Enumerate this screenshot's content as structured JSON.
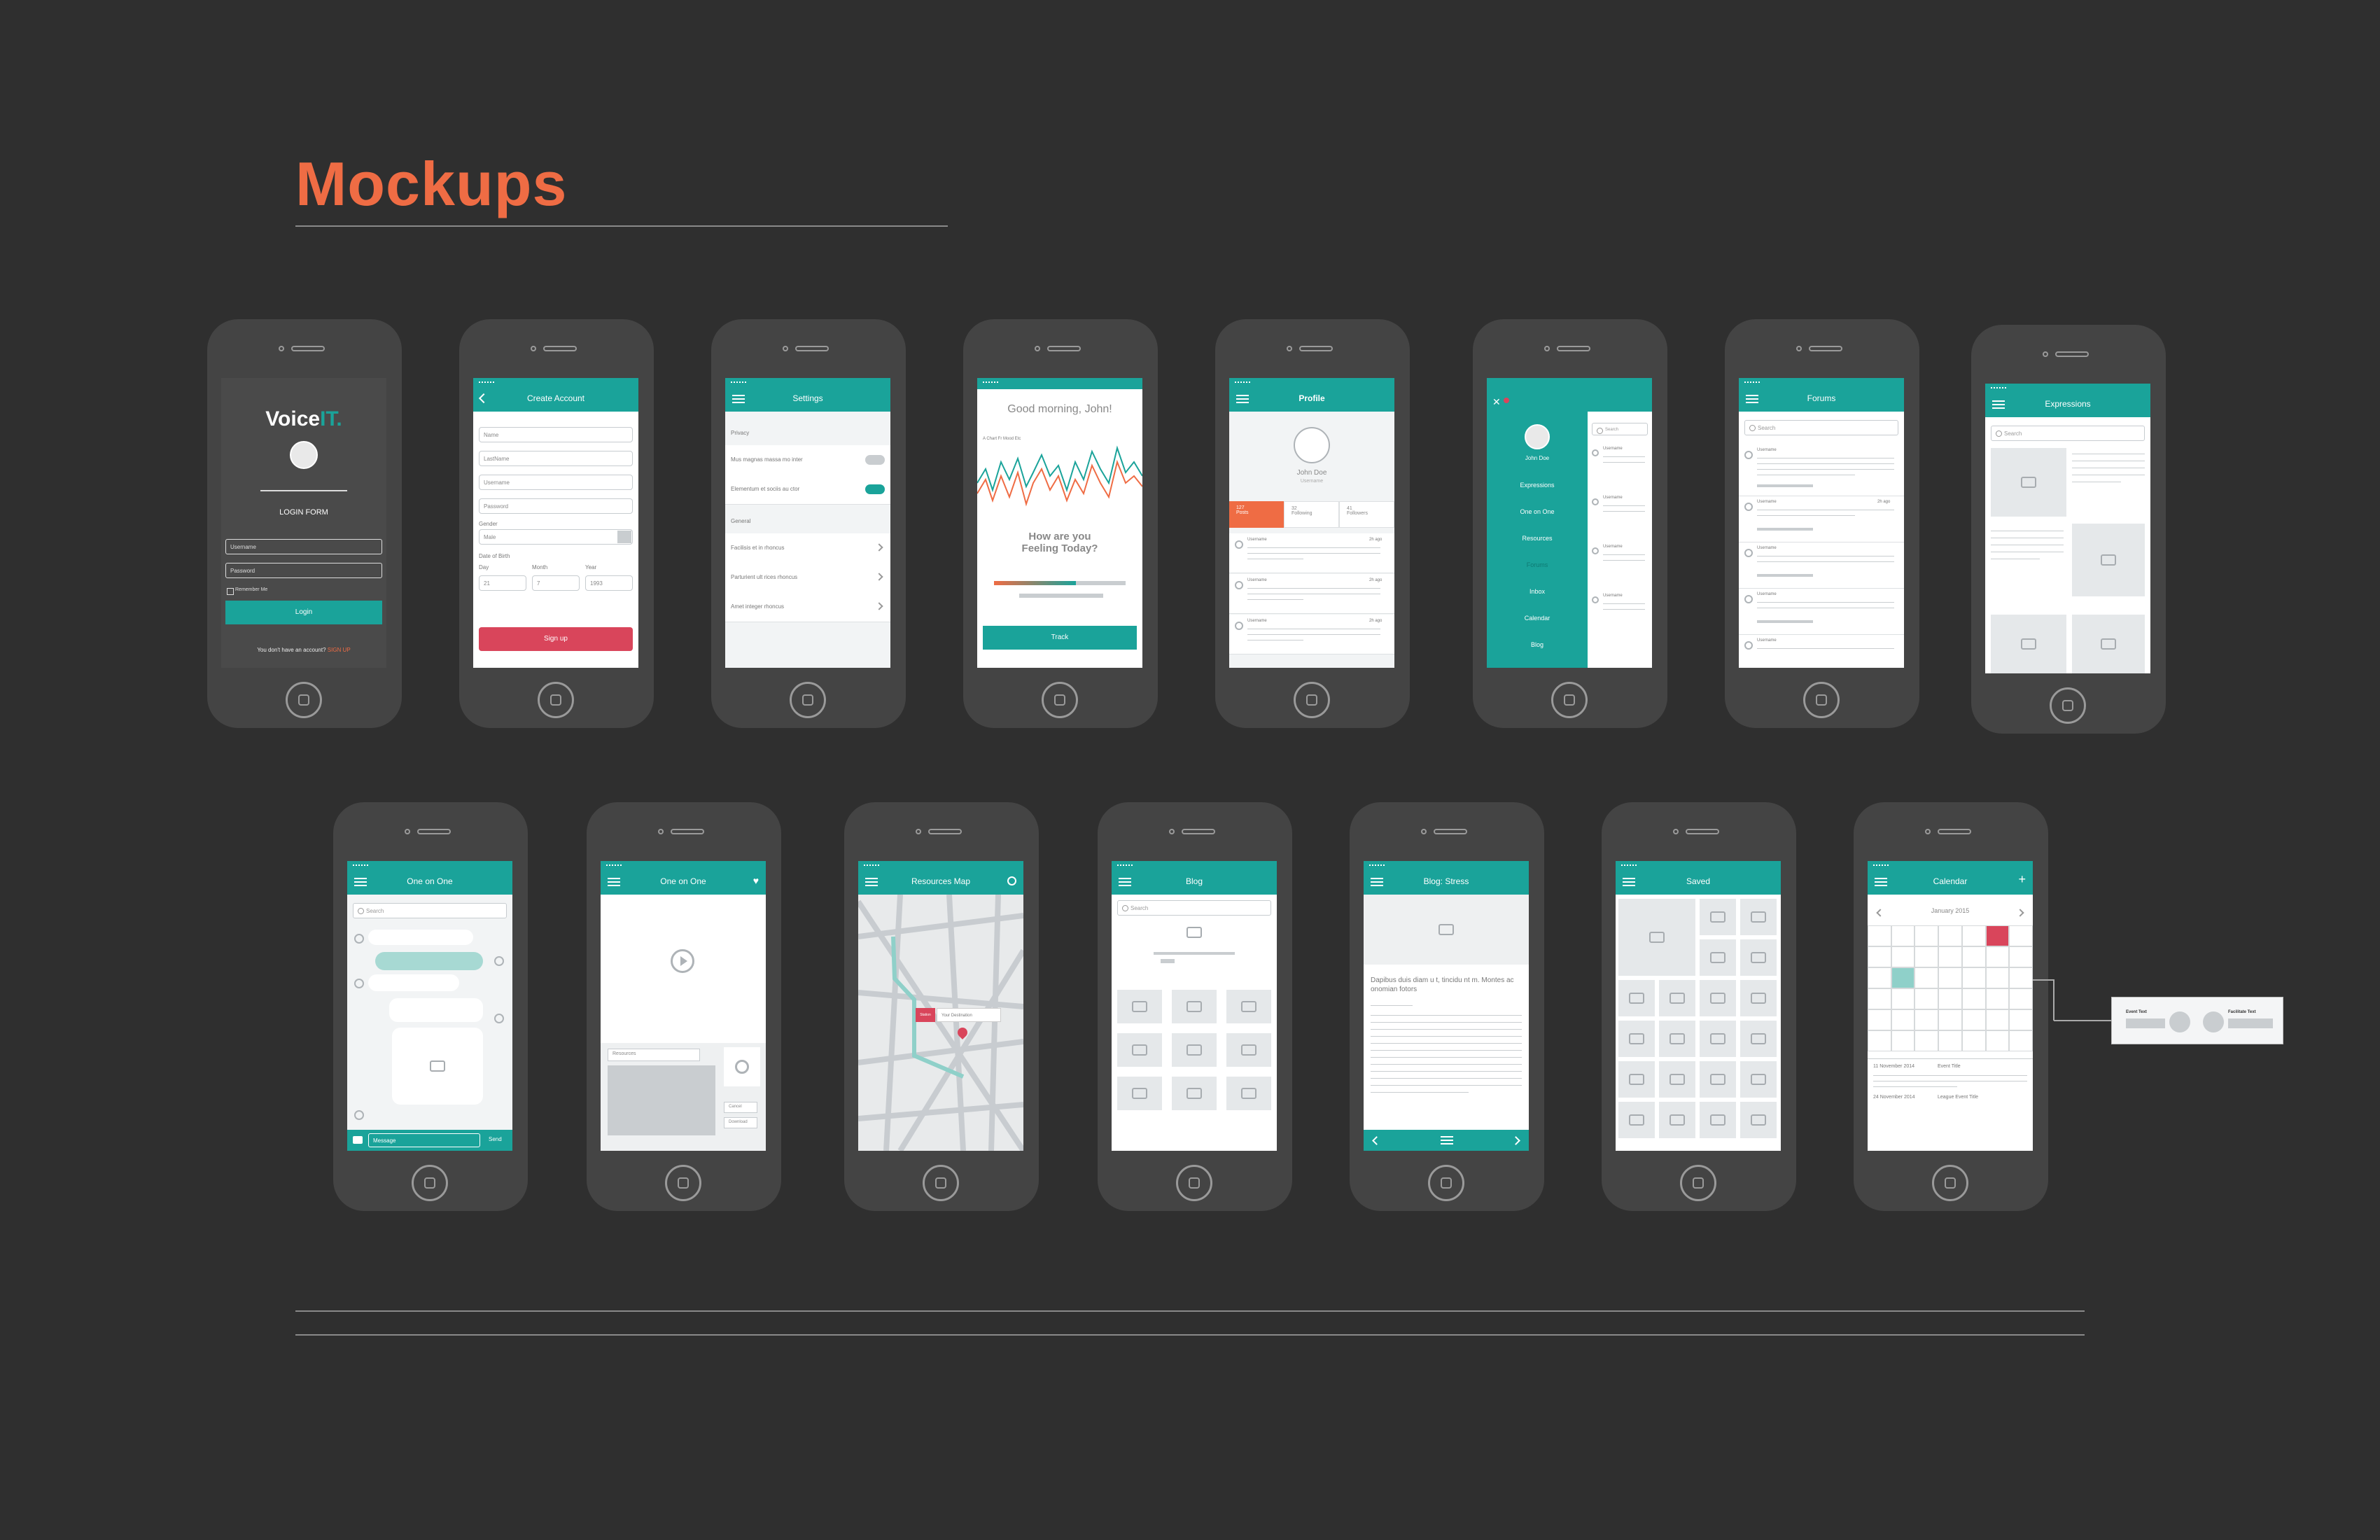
{
  "page": {
    "title": "Mockups",
    "accent": "#ef6c44",
    "teal": "#1aa39a",
    "red": "#d9455b"
  },
  "login": {
    "logo_a": "Voice",
    "logo_b": "IT.",
    "form_title": "LOGIN FORM",
    "username": "Username",
    "password": "Password",
    "remember": "Remember Me",
    "button": "Login",
    "no_account": "You don't have an account?",
    "signup": "SIGN UP"
  },
  "create": {
    "title": "Create Account",
    "fields": [
      "Name",
      "LastName",
      "Username",
      "Password"
    ],
    "gender_label": "Gender",
    "gender_value": "Male",
    "dob_label": "Date of Birth",
    "day_label": "Day",
    "month_label": "Month",
    "year_label": "Year",
    "day": "21",
    "month": "7",
    "year": "1993",
    "button": "Sign up"
  },
  "settings": {
    "title": "Settings",
    "privacy": "Privacy",
    "toggles": [
      "Mus magnas massa mo inter",
      "Elementum et sociis au ctor"
    ],
    "general": "General",
    "items": [
      "Facilisis et in rhoncus",
      "Parturient ult rices rhoncus",
      "Amet integer rhoncus"
    ]
  },
  "track": {
    "greeting": "Good morning, John!",
    "chart_label": "A Chart Fr Mood Etc",
    "question": "How are you Feeling Today?",
    "button": "Track",
    "mood_level": 0.62
  },
  "profile": {
    "title": "Profile",
    "name": "John Doe",
    "sub": "Username",
    "stats": [
      {
        "n": "127",
        "l": "Posts"
      },
      {
        "n": "32",
        "l": "Following"
      },
      {
        "n": "41",
        "l": "Followers"
      }
    ],
    "post_user": "Username",
    "post_time": "2h ago"
  },
  "menu": {
    "name": "John Doe",
    "items": [
      "Expressions",
      "One on One",
      "Resources",
      "Forums",
      "Inbox",
      "Calendar",
      "Blog"
    ],
    "search": "Search",
    "list_user": "Username"
  },
  "forums": {
    "title": "Forums",
    "search": "Search",
    "user": "Username",
    "time": "2h ago"
  },
  "expressions": {
    "title": "Expressions",
    "search": "Search"
  },
  "chat": {
    "title": "One on One",
    "search": "Search",
    "message": "Message",
    "send": "Send"
  },
  "video": {
    "title": "One on One",
    "resources": "Resources",
    "cancel": "Cancel",
    "download": "Download"
  },
  "map": {
    "title": "Resources Map",
    "pin": "Station",
    "destination": "Your Destination"
  },
  "blog": {
    "title": "Blog",
    "search": "Search"
  },
  "blogpost": {
    "title": "Blog: Stress",
    "heading": "Dapibus duis diam u t, tincidu nt m. Montes ac onomian fotors"
  },
  "saved": {
    "title": "Saved"
  },
  "calendar": {
    "title": "Calendar",
    "month": "January 2015",
    "events": [
      {
        "date": "11 November 2014",
        "name": "Event Title"
      },
      {
        "date": "24 November 2014",
        "name": "League Event Title"
      }
    ],
    "popup_a": "Event Text",
    "popup_b": "Facilitate Text"
  }
}
